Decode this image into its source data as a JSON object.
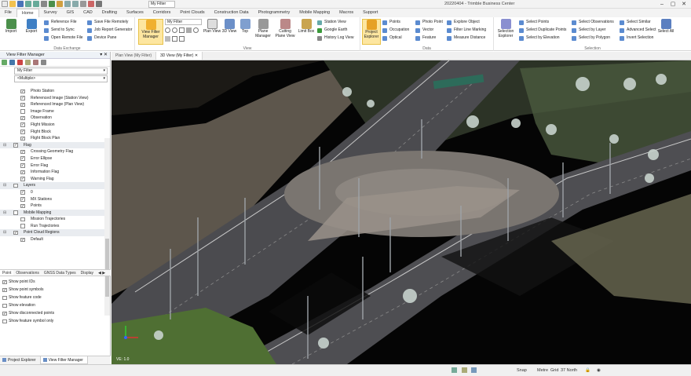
{
  "window": {
    "title": "20220404 - Trimble Business Center",
    "filter_value": "My Filter"
  },
  "tabs": [
    "File",
    "Home",
    "Survey",
    "GIS",
    "CAD",
    "Drafting",
    "Surfaces",
    "Corridors",
    "Point Clouds",
    "Construction Data",
    "Photogrammetry",
    "Mobile Mapping",
    "Macros",
    "Support"
  ],
  "ribbon": {
    "import": "Import",
    "export": "Export",
    "reference_file": "Reference File",
    "send_to_sync": "Send to Sync",
    "open_remote_file": "Open Remote File",
    "save_file_remotely": "Save File Remotely",
    "job_report_generator": "Job Report Generator",
    "device_pane": "Device Pane",
    "data_exchange": "Data Exchange",
    "view_filter_manager": "View Filter Manager",
    "view_filter_value": "My Filter",
    "plan_view": "Plan View",
    "view_3d": "3D View",
    "top": "Top",
    "plane_manager": "Plane Manager",
    "cutting_plane_view": "Cutting Plane View",
    "limit_box": "Limit Box",
    "station_view": "Station View",
    "google_earth": "Google Earth",
    "history_log_view": "History Log View",
    "view_group": "View",
    "project_explorer": "Project Explorer",
    "points": "Points",
    "occupation": "Occupation",
    "optical": "Optical",
    "photo_point": "Photo Point",
    "vector": "Vector",
    "feature": "Feature",
    "explore_object": "Explore Object",
    "filter_line_marking": "Filter Line Marking",
    "measure_distance": "Measure Distance",
    "data_group": "Data",
    "selection_explorer": "Selection Explorer",
    "select_points": "Select Points",
    "select_duplicate_points": "Select Duplicate Points",
    "select_by_elevation": "Select by Elevation",
    "select_observations": "Select Observations",
    "select_by_layer": "Select by Layer",
    "select_by_polygon": "Select by Polygon",
    "select_similar": "Select Similar",
    "advanced_select": "Advanced Select",
    "invert_selection": "Invert Selection",
    "select_all": "Select All",
    "selection_group": "Selection"
  },
  "panel": {
    "title": "View Filter Manager",
    "filter_value": "My Filter",
    "multiple_value": "<Multiple>",
    "tree": [
      {
        "label": "Photo Station",
        "checked": true,
        "kind": "child"
      },
      {
        "label": "Referenced Image (Station View)",
        "checked": true,
        "kind": "child"
      },
      {
        "label": "Referenced Image (Plan View)",
        "checked": true,
        "kind": "child"
      },
      {
        "label": "Image Frame",
        "checked": false,
        "kind": "child"
      },
      {
        "label": "Observation",
        "checked": true,
        "kind": "child"
      },
      {
        "label": "Flight Mission",
        "checked": true,
        "kind": "child"
      },
      {
        "label": "Flight Block",
        "checked": true,
        "kind": "child"
      },
      {
        "label": "Flight Block Plan",
        "checked": true,
        "kind": "child"
      },
      {
        "label": "Flag",
        "checked": true,
        "kind": "group"
      },
      {
        "label": "Crossing Geometry Flag",
        "checked": true,
        "kind": "child"
      },
      {
        "label": "Error Ellipse",
        "checked": true,
        "kind": "child"
      },
      {
        "label": "Error Flag",
        "checked": true,
        "kind": "child"
      },
      {
        "label": "Information Flag",
        "checked": true,
        "kind": "child"
      },
      {
        "label": "Warning Flag",
        "checked": true,
        "kind": "child"
      },
      {
        "label": "Layers",
        "checked": false,
        "kind": "group"
      },
      {
        "label": "0",
        "checked": true,
        "kind": "child"
      },
      {
        "label": "MX Stations",
        "checked": true,
        "kind": "child"
      },
      {
        "label": "Points",
        "checked": true,
        "kind": "child"
      },
      {
        "label": "Mobile Mapping",
        "checked": false,
        "kind": "group"
      },
      {
        "label": "Mission Trajectories",
        "checked": false,
        "kind": "child"
      },
      {
        "label": "Run Trajectories",
        "checked": false,
        "kind": "child"
      },
      {
        "label": "Point Cloud Regions",
        "checked": true,
        "kind": "group"
      },
      {
        "label": "Default",
        "checked": true,
        "kind": "child"
      }
    ],
    "subtabs": [
      "Point",
      "Observations",
      "GNSS Data Types",
      "Display"
    ],
    "options": [
      {
        "label": "Show point IDs",
        "checked": true
      },
      {
        "label": "Show point symbols",
        "checked": true
      },
      {
        "label": "Show feature code",
        "checked": false
      },
      {
        "label": "Show elevation",
        "checked": false
      },
      {
        "label": "Show disconnected points",
        "checked": true
      },
      {
        "label": "Show feature symbol only",
        "checked": false
      }
    ],
    "bottom_tabs": [
      "Project Explorer",
      "View Filter Manager"
    ]
  },
  "doc_tabs": [
    "Plan View (My Filter)",
    "3D View (My Filter)"
  ],
  "viewport": {
    "label": "VE: 1.0"
  },
  "status": {
    "snap": "Snap",
    "units": "Metre",
    "grid": "Grid",
    "zone": "37 North"
  }
}
